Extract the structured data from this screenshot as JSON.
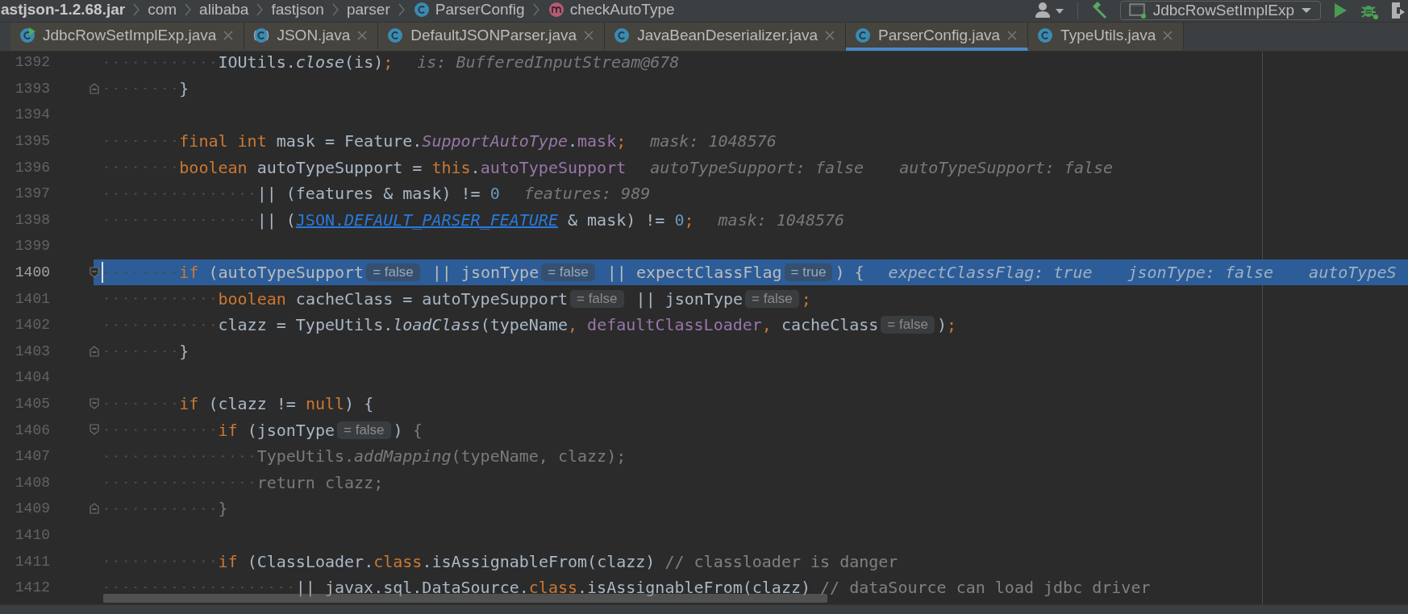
{
  "breadcrumbs": [
    {
      "label": "astjson-1.2.68.jar",
      "kind": "archive"
    },
    {
      "label": "com",
      "kind": "package"
    },
    {
      "label": "alibaba",
      "kind": "package"
    },
    {
      "label": "fastjson",
      "kind": "package"
    },
    {
      "label": "parser",
      "kind": "package"
    },
    {
      "label": "ParserConfig",
      "kind": "class"
    },
    {
      "label": "checkAutoType",
      "kind": "method"
    }
  ],
  "toolbar": {
    "run_configuration": "JdbcRowSetImplExp"
  },
  "tabs": [
    {
      "label": "JdbcRowSetImplExp.java",
      "kind": "runnable-class",
      "selected": false
    },
    {
      "label": "JSON.java",
      "kind": "library-class",
      "selected": false
    },
    {
      "label": "DefaultJSONParser.java",
      "kind": "class",
      "selected": false
    },
    {
      "label": "JavaBeanDeserializer.java",
      "kind": "class",
      "selected": false
    },
    {
      "label": "ParserConfig.java",
      "kind": "class",
      "selected": true
    },
    {
      "label": "TypeUtils.java",
      "kind": "class",
      "selected": false
    }
  ],
  "editor": {
    "lines": [
      {
        "number": "1392",
        "highlighted": false,
        "caret": false,
        "tokens": [
          {
            "kind": "plain",
            "text": "            IOUtils."
          },
          {
            "kind": "static-call",
            "text": "close"
          },
          {
            "kind": "plain",
            "text": "(is)"
          },
          {
            "kind": "keyword",
            "text": ";"
          },
          {
            "kind": "debug-hint",
            "text": "is: BufferedInputStream@678"
          }
        ]
      },
      {
        "number": "1393",
        "highlighted": false,
        "caret": false,
        "fold": {
          "kind": "end"
        },
        "tokens": [
          {
            "kind": "plain",
            "text": "        }"
          }
        ]
      },
      {
        "number": "1394",
        "highlighted": false,
        "caret": false
      },
      {
        "number": "1395",
        "highlighted": false,
        "caret": false,
        "tokens": [
          {
            "kind": "keyword",
            "text": "        final int"
          },
          {
            "kind": "plain",
            "text": " mask = Feature."
          },
          {
            "kind": "static-field",
            "text": "SupportAutoType"
          },
          {
            "kind": "plain",
            "text": "."
          },
          {
            "kind": "field",
            "text": "mask"
          },
          {
            "kind": "keyword",
            "text": ";"
          },
          {
            "kind": "debug-hint",
            "text": "mask: 1048576"
          }
        ]
      },
      {
        "number": "1396",
        "highlighted": false,
        "caret": false,
        "tokens": [
          {
            "kind": "keyword",
            "text": "        boolean"
          },
          {
            "kind": "plain",
            "text": " autoTypeSupport = "
          },
          {
            "kind": "keyword",
            "text": "this"
          },
          {
            "kind": "plain",
            "text": "."
          },
          {
            "kind": "field",
            "text": "autoTypeSupport"
          },
          {
            "kind": "debug-hint",
            "text": "autoTypeSupport: false"
          },
          {
            "kind": "debug-hint",
            "text": "autoTypeSupport: false"
          }
        ]
      },
      {
        "number": "1397",
        "highlighted": false,
        "caret": false,
        "tokens": [
          {
            "kind": "plain",
            "text": "                || (features & mask) != "
          },
          {
            "kind": "number",
            "text": "0"
          },
          {
            "kind": "debug-hint",
            "text": "features: 989"
          }
        ]
      },
      {
        "number": "1398",
        "highlighted": false,
        "caret": false,
        "tokens": [
          {
            "kind": "plain",
            "text": "                || ("
          },
          {
            "kind": "link",
            "text": "JSON."
          },
          {
            "kind": "link-static",
            "text": "DEFAULT_PARSER_FEATURE"
          },
          {
            "kind": "plain",
            "text": " & mask) != "
          },
          {
            "kind": "number",
            "text": "0"
          },
          {
            "kind": "keyword",
            "text": ";"
          },
          {
            "kind": "debug-hint",
            "text": "mask: 1048576"
          }
        ]
      },
      {
        "number": "1399",
        "highlighted": false,
        "caret": false
      },
      {
        "number": "1400",
        "highlighted": true,
        "caret": true,
        "fold": {
          "kind": "start"
        },
        "tokens": [
          {
            "kind": "keyword",
            "text": "        if"
          },
          {
            "kind": "plain",
            "text": " (autoTypeSupport"
          },
          {
            "kind": "value-chip",
            "text": "= false"
          },
          {
            "kind": "plain",
            "text": " || jsonType"
          },
          {
            "kind": "value-chip",
            "text": "= false"
          },
          {
            "kind": "plain",
            "text": " || expectClassFlag"
          },
          {
            "kind": "value-chip",
            "text": "= true"
          },
          {
            "kind": "plain",
            "text": ") {"
          },
          {
            "kind": "debug-hint",
            "text": "expectClassFlag: true"
          },
          {
            "kind": "debug-hint",
            "text": "jsonType: false"
          },
          {
            "kind": "debug-hint",
            "text": "autoTypeS"
          }
        ]
      },
      {
        "number": "1401",
        "highlighted": false,
        "caret": false,
        "tokens": [
          {
            "kind": "keyword",
            "text": "            boolean"
          },
          {
            "kind": "plain",
            "text": " cacheClass = autoTypeSupport"
          },
          {
            "kind": "value-chip",
            "text": "= false"
          },
          {
            "kind": "plain",
            "text": " || jsonType"
          },
          {
            "kind": "value-chip",
            "text": "= false"
          },
          {
            "kind": "keyword",
            "text": ";"
          }
        ]
      },
      {
        "number": "1402",
        "highlighted": false,
        "caret": false,
        "tokens": [
          {
            "kind": "plain",
            "text": "            clazz = TypeUtils."
          },
          {
            "kind": "static-call",
            "text": "loadClass"
          },
          {
            "kind": "plain",
            "text": "(typeName"
          },
          {
            "kind": "keyword",
            "text": ", "
          },
          {
            "kind": "field",
            "text": "defaultClassLoader"
          },
          {
            "kind": "keyword",
            "text": ","
          },
          {
            "kind": "plain",
            "text": " cacheClass"
          },
          {
            "kind": "value-chip",
            "text": "= false"
          },
          {
            "kind": "plain",
            "text": ")"
          },
          {
            "kind": "keyword",
            "text": ";"
          }
        ]
      },
      {
        "number": "1403",
        "highlighted": false,
        "caret": false,
        "fold": {
          "kind": "end"
        },
        "tokens": [
          {
            "kind": "plain",
            "text": "        }"
          }
        ]
      },
      {
        "number": "1404",
        "highlighted": false,
        "caret": false
      },
      {
        "number": "1405",
        "highlighted": false,
        "caret": false,
        "fold": {
          "kind": "start"
        },
        "tokens": [
          {
            "kind": "keyword",
            "text": "        if"
          },
          {
            "kind": "plain",
            "text": " (clazz != "
          },
          {
            "kind": "keyword",
            "text": "null"
          },
          {
            "kind": "plain",
            "text": ") {"
          }
        ]
      },
      {
        "number": "1406",
        "highlighted": false,
        "caret": false,
        "fold": {
          "kind": "start"
        },
        "tokens": [
          {
            "kind": "keyword",
            "text": "            if"
          },
          {
            "kind": "plain",
            "text": " (jsonType"
          },
          {
            "kind": "value-chip",
            "text": "= false"
          },
          {
            "kind": "plain",
            "text": ")"
          },
          {
            "kind": "dim",
            "text": " {"
          }
        ]
      },
      {
        "number": "1407",
        "highlighted": false,
        "caret": false,
        "tokens": [
          {
            "kind": "dim",
            "text": "                TypeUtils."
          },
          {
            "kind": "dim-call",
            "text": "addMapping"
          },
          {
            "kind": "dim",
            "text": "(typeName, clazz);"
          }
        ]
      },
      {
        "number": "1408",
        "highlighted": false,
        "caret": false,
        "tokens": [
          {
            "kind": "dim",
            "text": "                return clazz;"
          }
        ]
      },
      {
        "number": "1409",
        "highlighted": false,
        "caret": false,
        "fold": {
          "kind": "end"
        },
        "tokens": [
          {
            "kind": "dim",
            "text": "            }"
          }
        ]
      },
      {
        "number": "1410",
        "highlighted": false,
        "caret": false
      },
      {
        "number": "1411",
        "highlighted": false,
        "caret": false,
        "tokens": [
          {
            "kind": "keyword",
            "text": "            if"
          },
          {
            "kind": "plain",
            "text": " (ClassLoader."
          },
          {
            "kind": "keyword",
            "text": "class"
          },
          {
            "kind": "plain",
            "text": ".isAssignableFrom(clazz) "
          },
          {
            "kind": "comment",
            "text": "// classloader is danger"
          }
        ]
      },
      {
        "number": "1412",
        "highlighted": false,
        "caret": false,
        "tokens": [
          {
            "kind": "plain",
            "text": "                    || javax.sql.DataSource."
          },
          {
            "kind": "keyword",
            "text": "class"
          },
          {
            "kind": "plain",
            "text": ".isAssignableFrom(clazz) "
          },
          {
            "kind": "comment",
            "text": "// dataSource can load jdbc driver"
          }
        ]
      }
    ]
  }
}
